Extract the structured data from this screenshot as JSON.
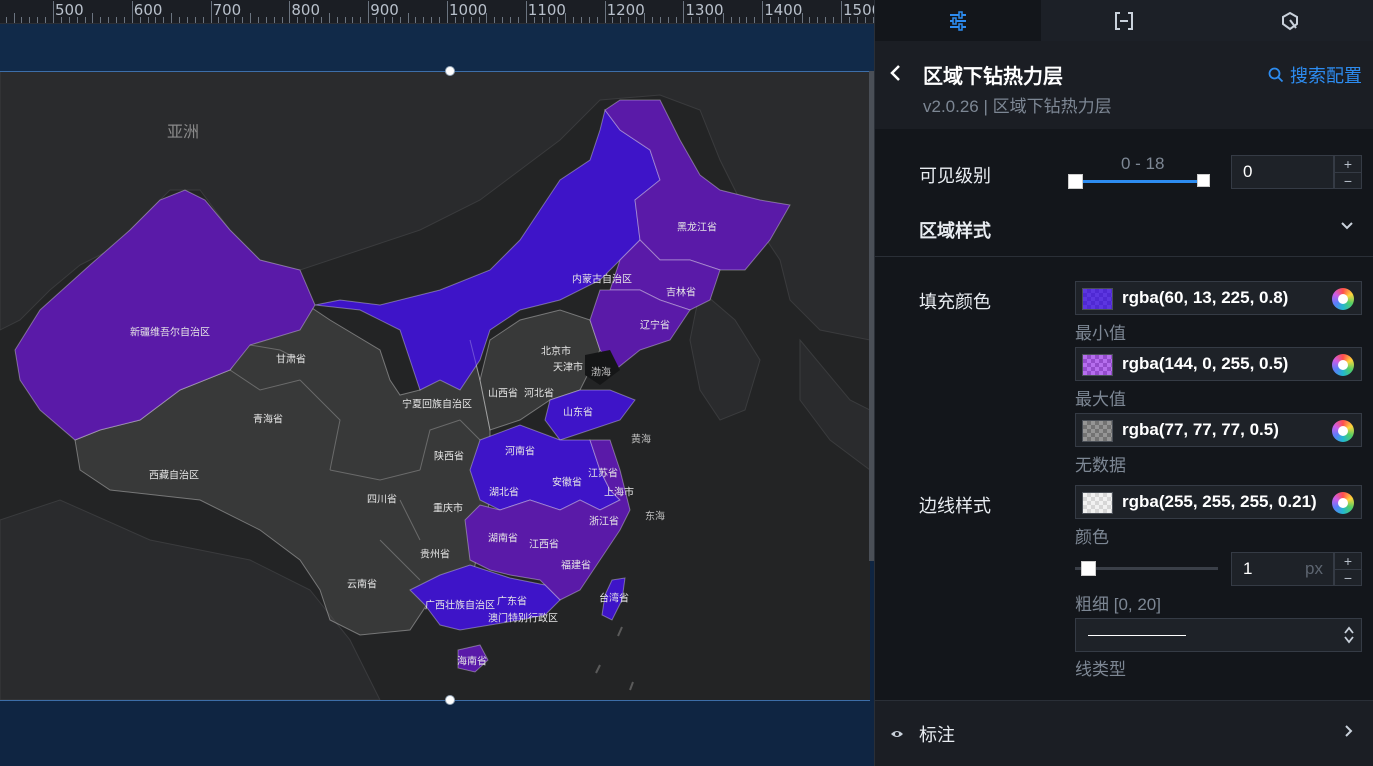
{
  "ruler": {
    "labels": [
      "500",
      "600",
      "700",
      "800",
      "900",
      "1000",
      "1100",
      "1200",
      "1300",
      "1400",
      "1500"
    ]
  },
  "map": {
    "continent_label": "亚洲",
    "sea_labels": [
      "渤海",
      "黄海",
      "东海"
    ],
    "provinces": [
      {
        "name": "黑龙江省",
        "tier": "max"
      },
      {
        "name": "内蒙古自治区",
        "tier": "min"
      },
      {
        "name": "吉林省",
        "tier": "max"
      },
      {
        "name": "辽宁省",
        "tier": "max"
      },
      {
        "name": "新疆维吾尔自治区",
        "tier": "max"
      },
      {
        "name": "甘肃省",
        "tier": "none"
      },
      {
        "name": "北京市",
        "tier": "none"
      },
      {
        "name": "天津市",
        "tier": "none"
      },
      {
        "name": "河北省",
        "tier": "none"
      },
      {
        "name": "山西省",
        "tier": "none"
      },
      {
        "name": "宁夏回族自治区",
        "tier": "none"
      },
      {
        "name": "青海省",
        "tier": "none"
      },
      {
        "name": "山东省",
        "tier": "min"
      },
      {
        "name": "陕西省",
        "tier": "none"
      },
      {
        "name": "河南省",
        "tier": "min"
      },
      {
        "name": "西藏自治区",
        "tier": "none"
      },
      {
        "name": "江苏省",
        "tier": "max"
      },
      {
        "name": "安徽省",
        "tier": "min"
      },
      {
        "name": "上海市",
        "tier": "min"
      },
      {
        "name": "湖北省",
        "tier": "min"
      },
      {
        "name": "四川省",
        "tier": "none"
      },
      {
        "name": "重庆市",
        "tier": "none"
      },
      {
        "name": "浙江省",
        "tier": "max"
      },
      {
        "name": "湖南省",
        "tier": "max"
      },
      {
        "name": "江西省",
        "tier": "max"
      },
      {
        "name": "贵州省",
        "tier": "none"
      },
      {
        "name": "福建省",
        "tier": "max"
      },
      {
        "name": "云南省",
        "tier": "none"
      },
      {
        "name": "台湾省",
        "tier": "min"
      },
      {
        "name": "广西壮族自治区",
        "tier": "min"
      },
      {
        "name": "广东省",
        "tier": "min"
      },
      {
        "name": "澳门特别行政区",
        "tier": "min"
      },
      {
        "name": "海南省",
        "tier": "max"
      }
    ]
  },
  "panel": {
    "tabs": [
      {
        "icon": "sliders-icon",
        "active": true
      },
      {
        "icon": "bracket-icon",
        "active": false
      },
      {
        "icon": "interaction-icon",
        "active": false
      }
    ],
    "title": "区域下钻热力层",
    "version": "v2.0.26 | 区域下钻热力层",
    "search_config": "搜索配置",
    "visible_level": {
      "label": "可见级别",
      "range_text": "0 - 18",
      "value": "0",
      "min": 0,
      "max": 18,
      "from": 0,
      "to": 18
    },
    "region_style": {
      "label": "区域样式"
    },
    "fill_color": {
      "label": "填充颜色",
      "min": {
        "value": "rgba(60, 13, 225, 0.8)",
        "caption": "最小值"
      },
      "max": {
        "value": "rgba(144, 0, 255, 0.5)",
        "caption": "最大值"
      },
      "none": {
        "value": "rgba(77, 77, 77, 0.5)",
        "caption": "无数据"
      }
    },
    "border_style": {
      "label": "边线样式",
      "color": {
        "value": "rgba(255, 255, 255, 0.21)",
        "caption": "颜色"
      },
      "width": {
        "value": "1",
        "unit": "px",
        "caption": "粗细 [0, 20]",
        "min": 0,
        "max": 20
      },
      "line_type_caption": "线类型"
    },
    "annotation": {
      "label": "标注"
    }
  },
  "colors": {
    "accent": "#2d8cf0",
    "fill_min": "rgba(60, 13, 225, 0.8)",
    "fill_max": "rgba(144, 0, 255, 0.5)",
    "fill_none": "rgba(77, 77, 77, 0.5)",
    "border": "rgba(255, 255, 255, 0.21)"
  }
}
